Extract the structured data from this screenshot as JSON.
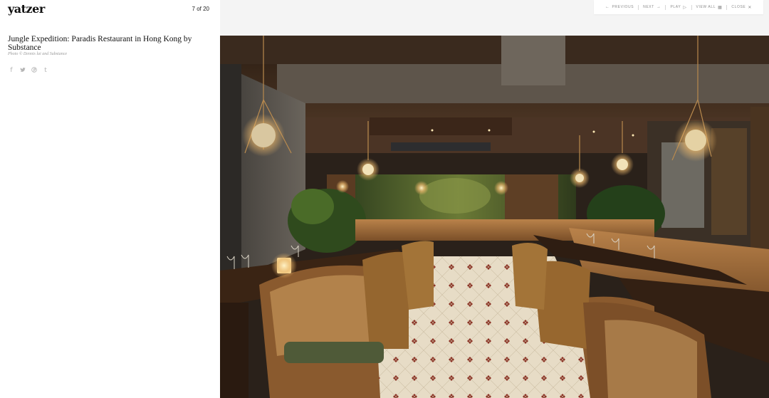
{
  "brand": {
    "logo": "yatzer"
  },
  "gallery": {
    "counter": "7 of 20",
    "title": "Jungle Expedition: Paradis Restaurant in Hong Kong by Substance",
    "credit": "Photo © Dennis lai and Substance"
  },
  "social": [
    {
      "name": "facebook-icon",
      "glyph": "f"
    },
    {
      "name": "twitter-icon",
      "glyph": "🐦"
    },
    {
      "name": "pinterest-icon",
      "glyph": "℗"
    },
    {
      "name": "tumblr-icon",
      "glyph": "t"
    }
  ],
  "nav": {
    "previous": "PREVIOUS",
    "next": "NEXT",
    "play": "PLAY",
    "view_all": "VIEW ALL",
    "close": "CLOSE"
  },
  "image": {
    "description_hidden": ""
  }
}
